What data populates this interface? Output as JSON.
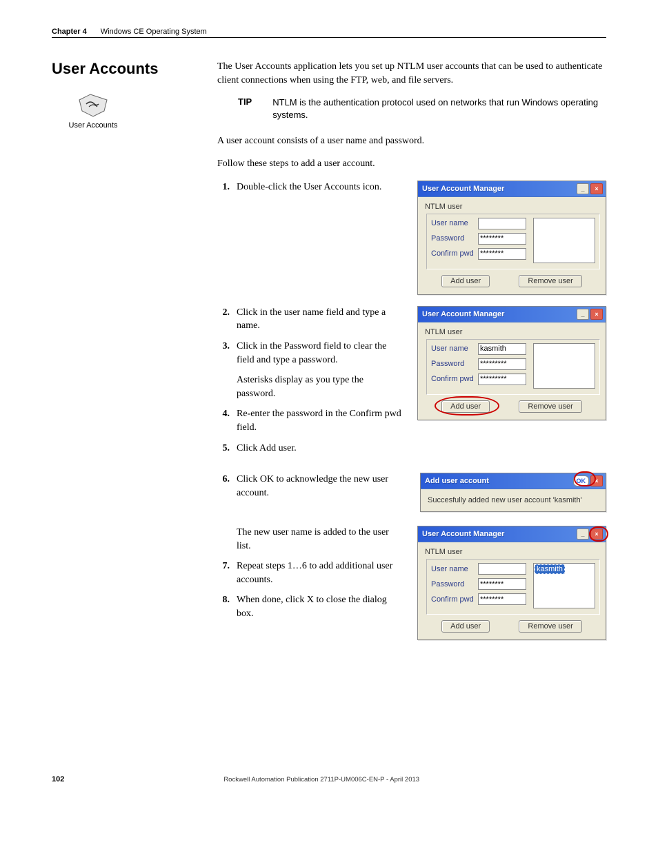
{
  "header": {
    "chapter": "Chapter 4",
    "chapter_title": "Windows CE Operating System"
  },
  "section_heading": "User Accounts",
  "icon_label": "User Accounts",
  "intro_paragraph": "The User Accounts application lets you set up NTLM user accounts that can be used to authenticate client connections when using the FTP, web, and file servers.",
  "tip": {
    "label": "TIP",
    "text": "NTLM is the authentication protocol used on networks that run Windows operating systems."
  },
  "para_account": "A user account consists of a user name and password.",
  "para_follow": "Follow these steps to add a user account.",
  "steps": {
    "s1": "Double-click the User Accounts icon.",
    "s2": "Click in the user name field and type a name.",
    "s3": "Click in the Password field to clear the field and type a password.",
    "s3_note": "Asterisks display as you type the password.",
    "s4": "Re-enter the password in the Confirm pwd field.",
    "s5": "Click Add user.",
    "s6": "Click OK to acknowledge the new user account.",
    "s6_note": "The new user name is added to the user list.",
    "s7": "Repeat steps 1…6 to add additional user accounts.",
    "s8": "When done, click X to close the dialog box."
  },
  "dialog": {
    "title": "User Account Manager",
    "group": "NTLM user",
    "labels": {
      "user": "User name",
      "pwd": "Password",
      "cpwd": "Confirm pwd"
    },
    "buttons": {
      "add": "Add user",
      "remove": "Remove user"
    },
    "shot1": {
      "user": "",
      "pwd": "********",
      "cpwd": "********"
    },
    "shot2": {
      "user": "kasmith",
      "pwd": "*********",
      "cpwd": "*********"
    },
    "shot3": {
      "user": "",
      "pwd": "********",
      "cpwd": "********",
      "list_sel": "kasmith"
    }
  },
  "msgbox": {
    "title": "Add user account",
    "ok": "OK",
    "text": "Succesfully added new user account 'kasmith'"
  },
  "footer": {
    "page": "102",
    "pub": "Rockwell Automation Publication 2711P-UM006C-EN-P - April 2013"
  }
}
